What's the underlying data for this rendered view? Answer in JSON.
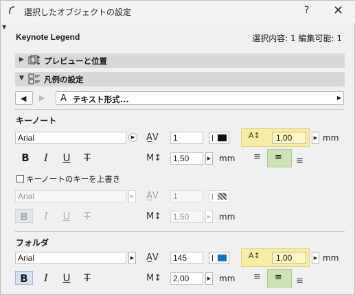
{
  "window": {
    "title": "選択したオブジェクトの設定",
    "help": "?",
    "close": "✕"
  },
  "header": {
    "name": "Keynote Legend",
    "selection": "選択内容: 1 編集可能: 1"
  },
  "sections": {
    "preview": "プレビューと位置",
    "legend": "凡例の設定"
  },
  "nav": {
    "text_style": "テキスト形式..."
  },
  "keynote": {
    "label": "キーノート",
    "font": "Arial",
    "size": "1",
    "line_height": "1,50",
    "spacing": "1,00",
    "unit": "mm"
  },
  "override": {
    "label": "キーノートのキーを上書き",
    "font": "Arial",
    "size": "1",
    "line_height": "1,50",
    "unit": "mm"
  },
  "folder": {
    "label": "フォルダ",
    "font": "Arial",
    "size": "145",
    "line_height": "2,00",
    "spacing": "1,00",
    "unit": "mm",
    "color": "#1a73b8"
  },
  "icons": {
    "bold": "B",
    "italic": "I",
    "underline": "U",
    "strike": "T"
  }
}
